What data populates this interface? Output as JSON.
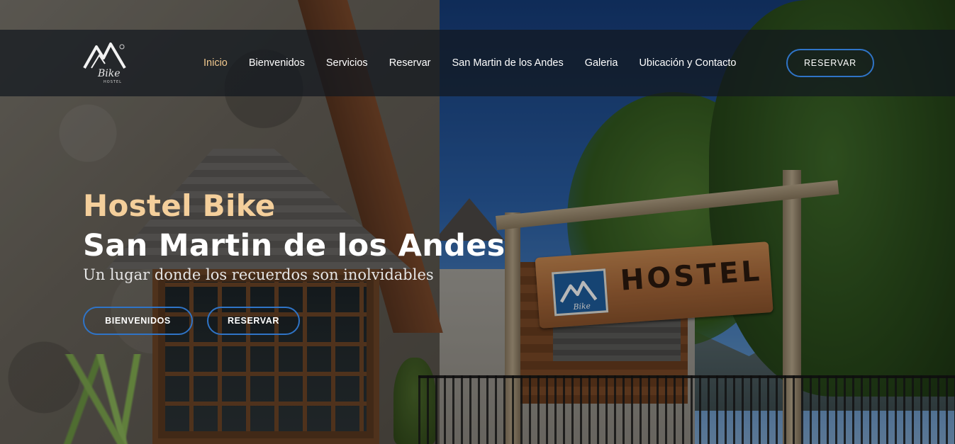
{
  "brand": {
    "logo_word": "Bike",
    "logo_sub": "HOSTEL"
  },
  "nav": {
    "items": [
      {
        "label": "Inicio",
        "active": true
      },
      {
        "label": "Bienvenidos",
        "active": false
      },
      {
        "label": "Servicios",
        "active": false
      },
      {
        "label": "Reservar",
        "active": false
      },
      {
        "label": "San Martin de los Andes",
        "active": false
      },
      {
        "label": "Galeria",
        "active": false
      },
      {
        "label": "Ubicación y Contacto",
        "active": false
      }
    ],
    "cta_label": "RESERVAR"
  },
  "hero": {
    "title_line1": "Hostel Bike",
    "title_line2": "San Martin de los Andes",
    "subtitle": "Un lugar donde los recuerdos son inolvidables",
    "buttons": [
      {
        "label": "BIENVENIDOS"
      },
      {
        "label": "RESERVAR"
      }
    ]
  },
  "sign": {
    "text": "HOSTEL",
    "logo_word": "Bike"
  },
  "colors": {
    "accent": "#f4cf9b",
    "button_border": "#2f74c7",
    "header_bg": "#12181e",
    "nav_active": "#f2c98f"
  }
}
